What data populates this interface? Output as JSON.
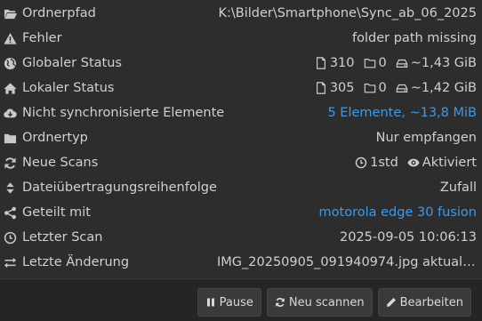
{
  "rows": [
    {
      "label": "Ordnerpfad",
      "icon": "folder-open-icon",
      "value": "K:\\Bilder\\Smartphone\\Sync_ab_06_2025"
    },
    {
      "label": "Fehler",
      "icon": "warning-icon",
      "value": "folder path missing"
    },
    {
      "label": "Globaler Status",
      "icon": "globe-icon",
      "files": "310",
      "dirs": "0",
      "size": "~1,43 GiB"
    },
    {
      "label": "Lokaler Status",
      "icon": "home-icon",
      "files": "305",
      "dirs": "0",
      "size": "~1,42 GiB"
    },
    {
      "label": "Nicht synchronisierte Elemente",
      "icon": "cloud-download-icon",
      "value": "5 Elemente, ~13,8 MiB"
    },
    {
      "label": "Ordnertyp",
      "icon": "folder-icon",
      "value": "Nur empfangen"
    },
    {
      "label": "Neue Scans",
      "icon": "refresh-icon",
      "interval": "1std",
      "watch": "Aktiviert"
    },
    {
      "label": "Dateiübertragungsreihenfolge",
      "icon": "sort-icon",
      "value": "Zufall"
    },
    {
      "label": "Geteilt mit",
      "icon": "share-icon",
      "value": "motorola edge 30 fusion"
    },
    {
      "label": "Letzter Scan",
      "icon": "clock-icon",
      "value": "2025-09-05 10:06:13"
    },
    {
      "label": "Letzte Änderung",
      "icon": "exchange-icon",
      "value": "IMG_20250905_091940974.jpg aktualisi..."
    }
  ],
  "buttons": {
    "pause": "Pause",
    "rescan": "Neu scannen",
    "edit": "Bearbeiten"
  },
  "colors": {
    "background": "#2d2d2d",
    "link": "#3d9ae8",
    "text": "#d0d0d0"
  }
}
